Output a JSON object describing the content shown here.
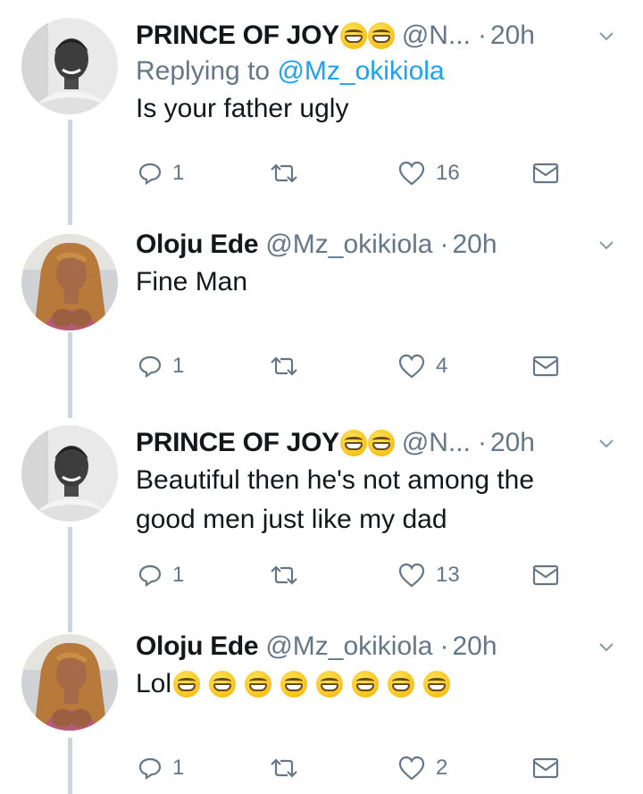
{
  "tweets": [
    {
      "name": "PRINCE OF JOY",
      "emoji_count": 2,
      "handle": "@N...",
      "dot": "·",
      "time": "20h",
      "replying_prefix": "Replying to",
      "replying_to": "@Mz_okikiola",
      "text": "Is your father ugly",
      "replies": "1",
      "likes": "16",
      "avatar": "man-avatar"
    },
    {
      "name": "Oloju Ede",
      "emoji_count": 0,
      "handle": "@Mz_okikiola",
      "dot": "·",
      "time": "20h",
      "text": "Fine Man",
      "replies": "1",
      "likes": "4",
      "avatar": "woman-avatar"
    },
    {
      "name": "PRINCE OF JOY",
      "emoji_count": 2,
      "handle": "@N...",
      "dot": "·",
      "time": "20h",
      "text": "Beautiful then he's not among the good men just like my dad",
      "replies": "1",
      "likes": "13",
      "avatar": "man-avatar"
    },
    {
      "name": "Oloju Ede",
      "emoji_count": 0,
      "handle": "@Mz_okikiola",
      "dot": "·",
      "time": "20h",
      "text": "Lol",
      "text_emoji_count": 8,
      "replies": "1",
      "likes": "2",
      "avatar": "woman-avatar"
    }
  ],
  "colors": {
    "text": "#14171a",
    "secondary": "#657786",
    "link": "#1da1f2",
    "thread_line": "#ccd6dd"
  },
  "icons": [
    "reply-icon",
    "retweet-icon",
    "like-icon",
    "dm-icon",
    "chevron-down-icon",
    "grinning-emoji"
  ]
}
